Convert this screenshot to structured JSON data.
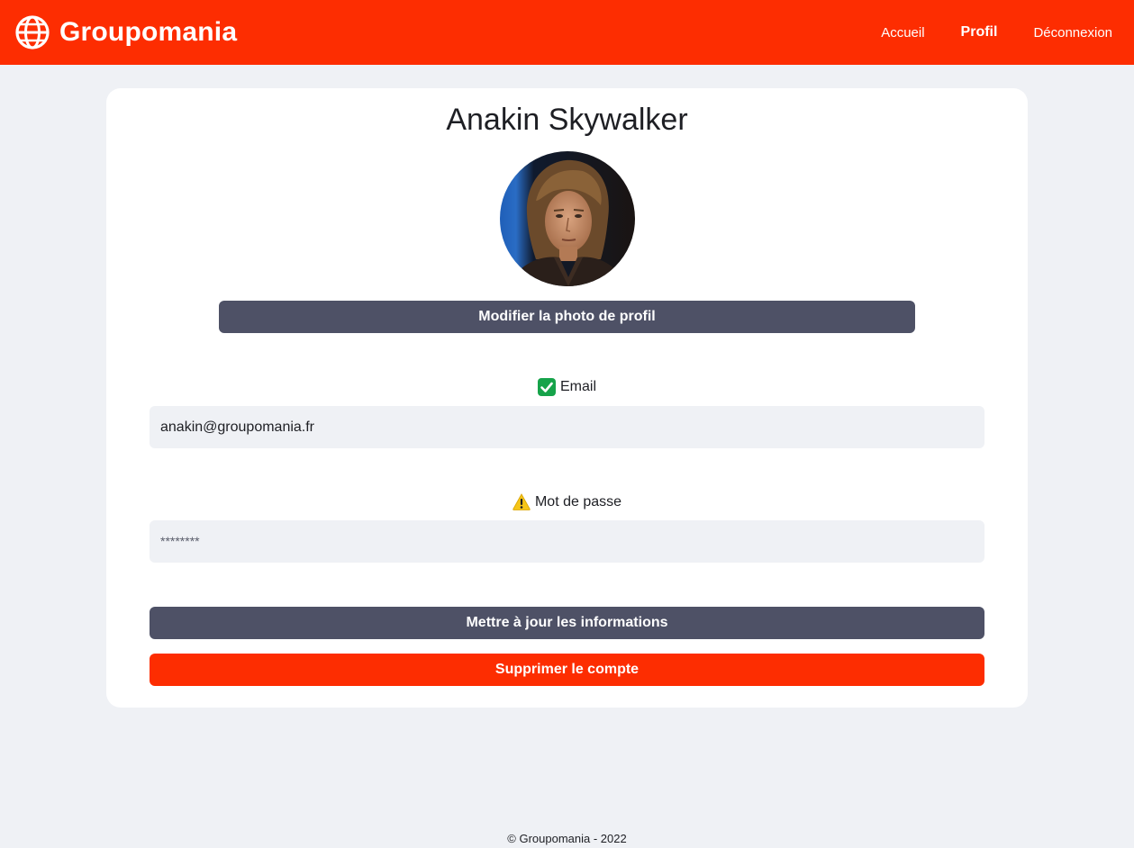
{
  "header": {
    "brand_name": "Groupomania",
    "brand_icon": "globe-icon",
    "nav": {
      "home": "Accueil",
      "profile": "Profil",
      "logout": "Déconnexion"
    }
  },
  "profile": {
    "name": "Anakin Skywalker",
    "avatar_icon": "avatar-photo",
    "change_photo_label": "Modifier la photo de profil"
  },
  "form": {
    "email": {
      "label": "Email",
      "status_icon": "check-mark-icon",
      "value": "anakin@groupomania.fr"
    },
    "password": {
      "label": "Mot de passe",
      "status_icon": "warning-icon",
      "placeholder": "********"
    },
    "update_label": "Mettre à jour les informations",
    "delete_label": "Supprimer le compte"
  },
  "footer": {
    "text": "© Groupomania - 2022"
  },
  "colors": {
    "brand": "#fd2d01",
    "secondary": "#4e5166",
    "background": "#eff1f5"
  }
}
